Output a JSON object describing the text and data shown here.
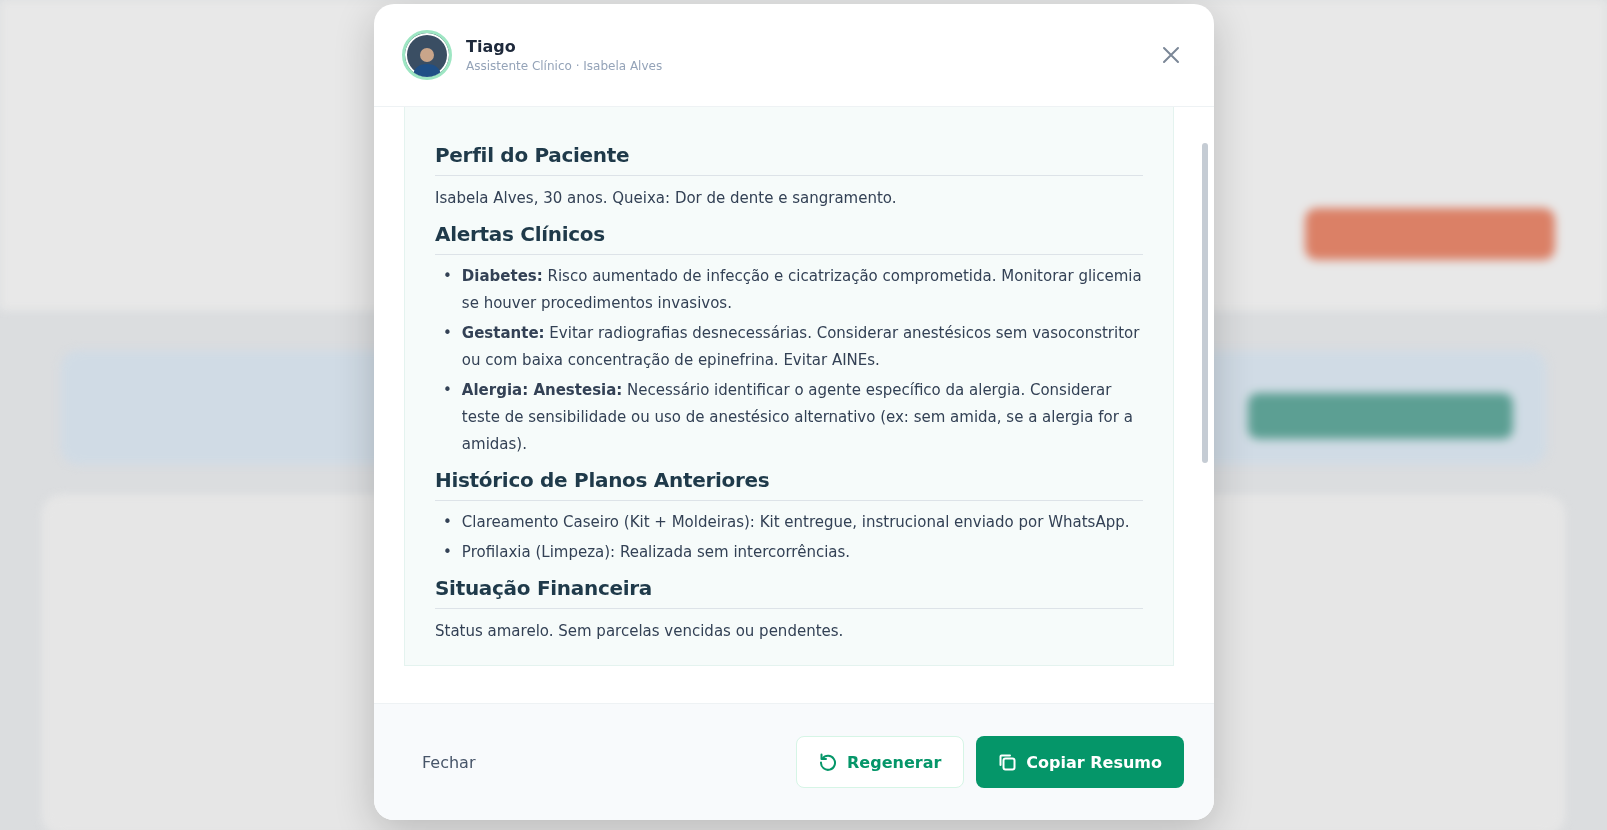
{
  "modal": {
    "assistant_name": "Tiago",
    "subtitle": "Assistente Clínico · Isabela Alves",
    "sections": [
      {
        "heading": "Perfil do Paciente",
        "kind": "text",
        "text": "Isabela Alves, 30 anos. Queixa: Dor de dente e sangramento."
      },
      {
        "heading": "Alertas Clínicos",
        "kind": "list",
        "marker": "•",
        "items": [
          "**Diabetes:** Risco aumentado de infecção e cicatrização comprometida. Monitorar glicemia se houver procedimentos invasivos.",
          "**Gestante:** Evitar radiografias desnecessárias. Considerar anestésicos sem vasoconstritor ou com baixa concentração de epinefrina. Evitar AINEs.",
          "**Alergia: Anestesia:** Necessário identificar o agente específico da alergia. Considerar teste de sensibilidade ou uso de anestésico alternativo (ex: sem amida, se a alergia for a amidas)."
        ]
      },
      {
        "heading": "Histórico de Planos Anteriores",
        "kind": "list",
        "marker": "•",
        "items": [
          "Clareamento Caseiro (Kit + Moldeiras): Kit entregue, instrucional enviado por WhatsApp.",
          "Profilaxia (Limpeza): Realizada sem intercorrências."
        ]
      },
      {
        "heading": "Situação Financeira",
        "kind": "text",
        "text": "Status amarelo. Sem parcelas vencidas ou pendentes."
      }
    ],
    "buttons": [
      {
        "label": "Fechar",
        "kind": "link"
      },
      {
        "label": "Regenerar",
        "kind": "secondary"
      },
      {
        "label": "Copiar Resumo",
        "kind": "primary"
      }
    ]
  }
}
